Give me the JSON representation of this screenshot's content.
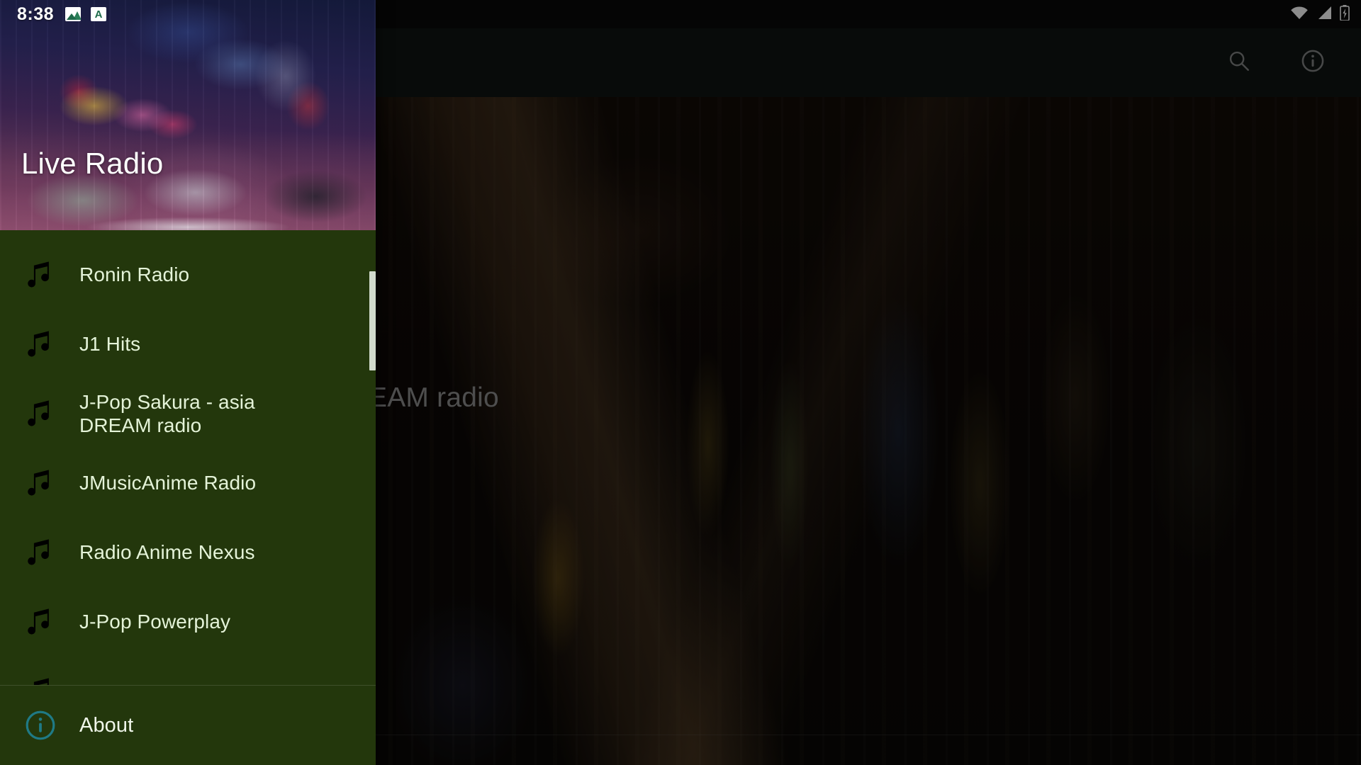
{
  "status_bar": {
    "clock": "8:38",
    "notification_icons": [
      "gallery-icon",
      "app-a-icon"
    ],
    "system_icons": [
      "wifi-icon",
      "cellular-signal-icon",
      "battery-charging-icon"
    ]
  },
  "app_bar": {
    "actions": [
      {
        "name": "search",
        "icon": "search-icon"
      },
      {
        "name": "info",
        "icon": "info-icon"
      }
    ]
  },
  "content": {
    "now_playing_title": "EAM radio",
    "background": "tokyo-street-photo"
  },
  "drawer": {
    "header": {
      "title": "Live Radio",
      "background": "tokyo-night-street-photo"
    },
    "items": [
      {
        "label": "Ronin Radio",
        "icon": "music-note-icon"
      },
      {
        "label": "J1 Hits",
        "icon": "music-note-icon"
      },
      {
        "label": "J-Pop Sakura - asia DREAM radio",
        "icon": "music-note-icon"
      },
      {
        "label": "JMusicAnime Radio",
        "icon": "music-note-icon"
      },
      {
        "label": "Radio Anime Nexus",
        "icon": "music-note-icon"
      },
      {
        "label": "J-Pop Powerplay",
        "icon": "music-note-icon"
      }
    ],
    "footer": {
      "label": "About",
      "icon": "info-circle-icon"
    },
    "scrollbar_visible": true
  },
  "colors": {
    "drawer_background": "#23370c",
    "drawer_text": "#e4f3d8",
    "app_bar_background": "#0f1513",
    "status_bar_background": "#0a0a0a",
    "accent_info": "#1f7a86",
    "scrollbar_thumb": "#d2dbcd"
  }
}
